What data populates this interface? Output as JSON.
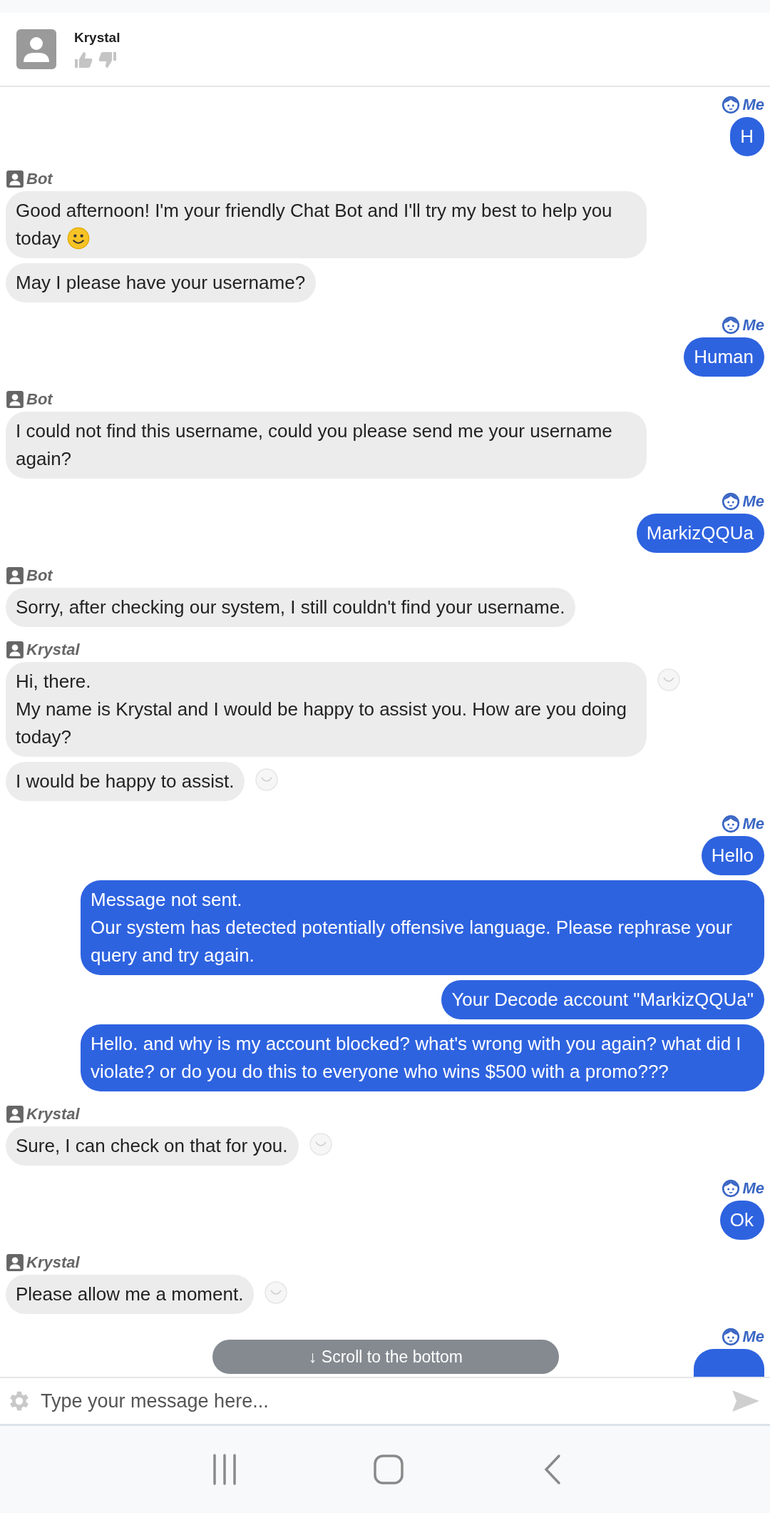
{
  "header": {
    "agent_name": "Krystal"
  },
  "groups": [
    {
      "kind": "me",
      "sender": "Me",
      "messages": [
        {
          "kind": "text",
          "text": "H"
        }
      ]
    },
    {
      "kind": "them",
      "sender": "Bot",
      "messages": [
        {
          "kind": "text",
          "text": "Good afternoon! I'm your friendly Chat Bot and I'll try my best to help you today",
          "emoji": true,
          "reaction": false
        },
        {
          "kind": "text",
          "text": "May I please have your username?",
          "emoji": false,
          "reaction": false
        }
      ]
    },
    {
      "kind": "me",
      "sender": "Me",
      "messages": [
        {
          "kind": "text",
          "text": "Human"
        }
      ]
    },
    {
      "kind": "them",
      "sender": "Bot",
      "messages": [
        {
          "kind": "text",
          "text": "I could not find this username, could you please send me your username again?",
          "emoji": false,
          "reaction": false
        }
      ]
    },
    {
      "kind": "me",
      "sender": "Me",
      "messages": [
        {
          "kind": "text",
          "text": "MarkizQQUa"
        }
      ]
    },
    {
      "kind": "them",
      "sender": "Bot",
      "messages": [
        {
          "kind": "text",
          "text": "Sorry, after checking our system, I still couldn't find your username.",
          "emoji": false,
          "reaction": false
        }
      ]
    },
    {
      "kind": "them",
      "sender": "Krystal",
      "messages": [
        {
          "kind": "text",
          "text": "Hi, there.\nMy name is Krystal and I would be happy to assist you. How are you doing today?",
          "emoji": false,
          "reaction": true
        },
        {
          "kind": "text",
          "text": "I would be happy to assist.",
          "emoji": false,
          "reaction": true
        }
      ]
    },
    {
      "kind": "me",
      "sender": "Me",
      "messages": [
        {
          "kind": "text",
          "text": "Hello"
        },
        {
          "kind": "text",
          "text": "Message not sent.\nOur system has detected potentially offensive language. Please rephrase your query and try again."
        },
        {
          "kind": "text",
          "text": "Your Decode account \"MarkizQQUa\""
        },
        {
          "kind": "text",
          "text": "Hello. and why is my account blocked? what's wrong with you again? what did I violate? or do you do this to everyone who wins $500 with a promo???"
        }
      ]
    },
    {
      "kind": "them",
      "sender": "Krystal",
      "messages": [
        {
          "kind": "text",
          "text": "Sure, I can check on that for you.",
          "emoji": false,
          "reaction": true
        }
      ]
    },
    {
      "kind": "me",
      "sender": "Me",
      "messages": [
        {
          "kind": "text",
          "text": "Ok"
        }
      ]
    },
    {
      "kind": "them",
      "sender": "Krystal",
      "messages": [
        {
          "kind": "text",
          "text": "Please allow me a moment.",
          "emoji": false,
          "reaction": true
        }
      ]
    },
    {
      "kind": "me",
      "sender": "Me",
      "messages": [
        {
          "kind": "partial"
        }
      ]
    }
  ],
  "scroll_button": {
    "label": "↓ Scroll to the bottom"
  },
  "composer": {
    "placeholder": "Type your message here..."
  }
}
